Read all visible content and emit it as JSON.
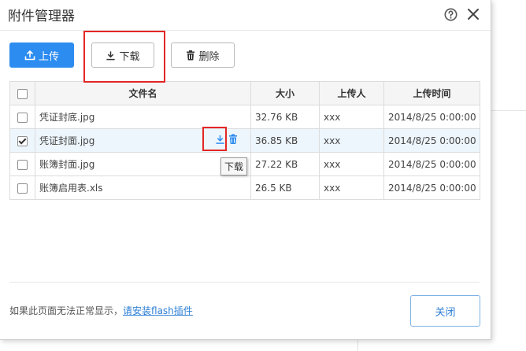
{
  "dialog": {
    "title": "附件管理器"
  },
  "toolbar": {
    "upload_label": "上传",
    "download_label": "下载",
    "delete_label": "删除"
  },
  "table": {
    "headers": {
      "name": "文件名",
      "size": "大小",
      "uploader": "上传人",
      "time": "上传时间"
    },
    "rows": [
      {
        "name": "凭证封底.jpg",
        "size": "32.76 KB",
        "uploader": "xxx",
        "time": "2014/8/25 0:00:00",
        "checked": false
      },
      {
        "name": "凭证封面.jpg",
        "size": "36.85 KB",
        "uploader": "xxx",
        "time": "2014/8/25 0:00:00",
        "checked": true
      },
      {
        "name": "账簿封面.jpg",
        "size": "27.22 KB",
        "uploader": "xxx",
        "time": "2014/8/25 0:00:00",
        "checked": false
      },
      {
        "name": "账簿启用表.xls",
        "size": "26.5 KB",
        "uploader": "xxx",
        "time": "2014/8/25 0:00:00",
        "checked": false
      }
    ]
  },
  "tooltip": {
    "text": "下载"
  },
  "footer": {
    "notice": "如果此页面无法正常显示，",
    "link": "请安装flash插件",
    "close_label": "关闭"
  },
  "colors": {
    "primary": "#2d8cf0",
    "highlight": "#e32626",
    "link": "#2d7fd6"
  }
}
